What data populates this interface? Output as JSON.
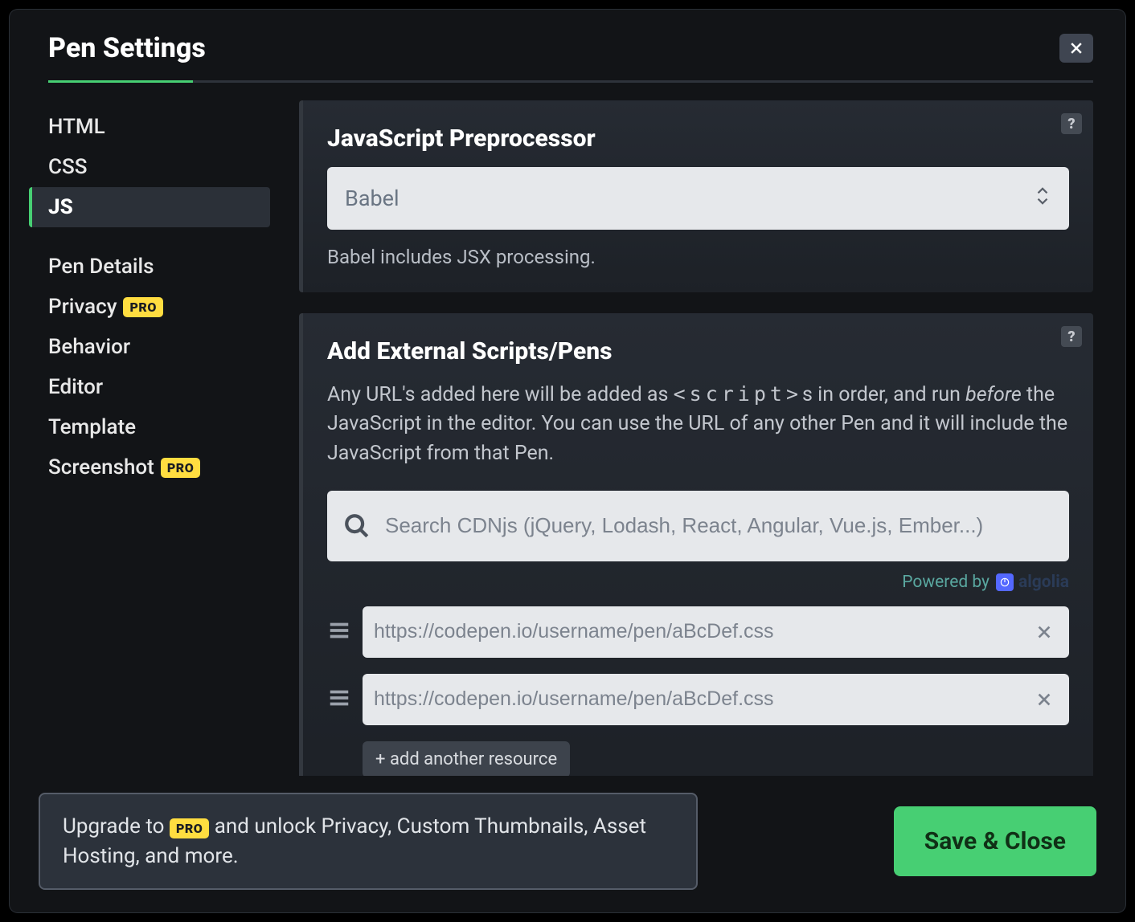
{
  "modal": {
    "title": "Pen Settings"
  },
  "sidebar": {
    "groups": {
      "top": [
        "HTML",
        "CSS",
        "JS"
      ],
      "bottom": [
        {
          "label": "Pen Details",
          "pro": false
        },
        {
          "label": "Privacy",
          "pro": true
        },
        {
          "label": "Behavior",
          "pro": false
        },
        {
          "label": "Editor",
          "pro": false
        },
        {
          "label": "Template",
          "pro": false
        },
        {
          "label": "Screenshot",
          "pro": true
        }
      ]
    },
    "active": "JS",
    "pro_badge": "PRO"
  },
  "panels": {
    "preprocessor": {
      "heading": "JavaScript Preprocessor",
      "help": "?",
      "selected": "Babel",
      "helper": "Babel includes JSX processing."
    },
    "external": {
      "heading": "Add External Scripts/Pens",
      "help": "?",
      "desc_parts": {
        "p1": "Any URL's added here will be added as ",
        "code": "<script>",
        "p2": "s in order, and run ",
        "em": "before",
        "p3": " the JavaScript in the editor. You can use the URL of any other Pen and it will include the JavaScript from that Pen."
      },
      "search_placeholder": "Search CDNjs (jQuery, Lodash, React, Angular, Vue.js, Ember...)",
      "powered_by": "Powered by",
      "algolia": "algolia",
      "resource_placeholder": "https://codepen.io/username/pen/aBcDef.css",
      "add_label": "+ add another resource"
    }
  },
  "footer": {
    "upgrade_p1": "Upgrade to ",
    "upgrade_badge": "PRO",
    "upgrade_p2": " and unlock Privacy, Custom Thumbnails, Asset Hosting, and more.",
    "save": "Save & Close"
  }
}
